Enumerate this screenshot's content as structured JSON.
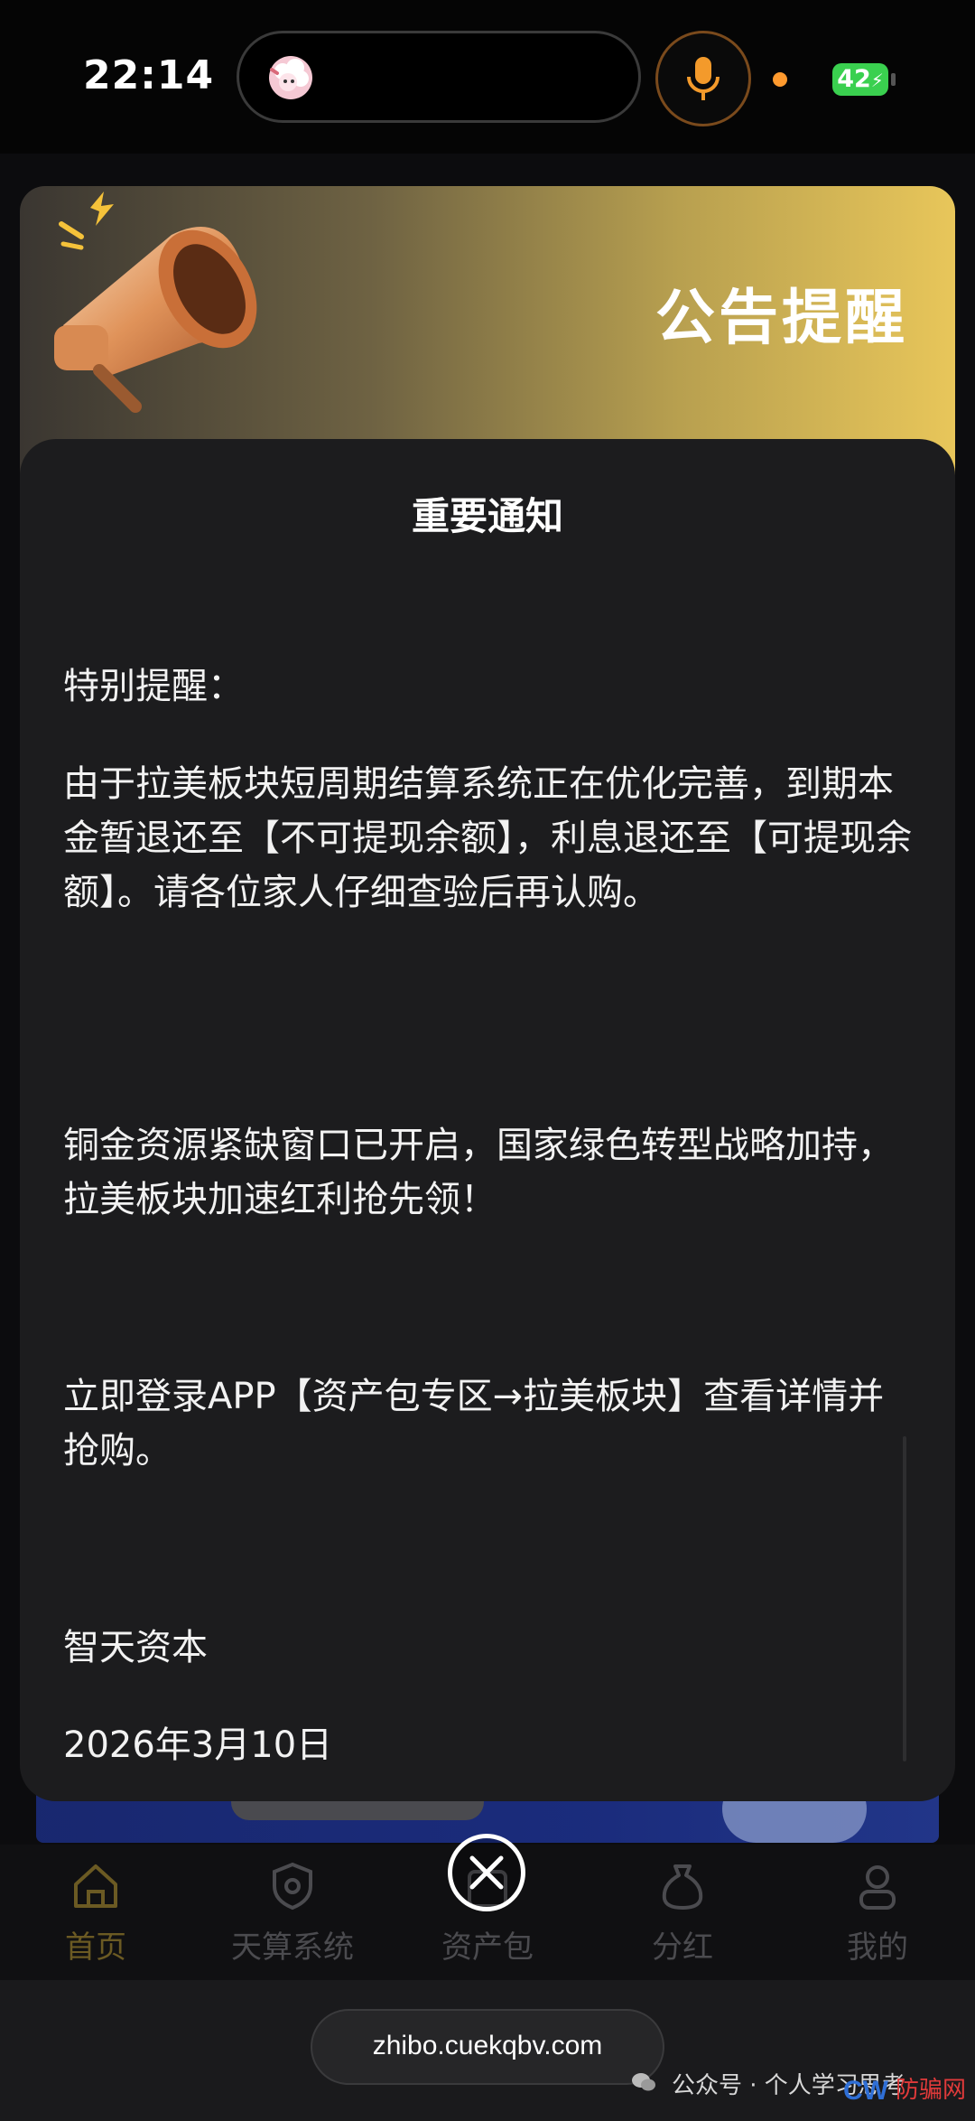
{
  "status_bar": {
    "time": "22:14",
    "battery": "42"
  },
  "modal": {
    "banner_title": "公告提醒",
    "heading": "重要通知",
    "paragraphs": [
      "特别提醒：",
      "由于拉美板块短周期结算系统正在优化完善，到期本金暂退还至【不可提现余额】，利息退还至【可提现余额】。请各位家人仔细查验后再认购。",
      "铜金资源紧缺窗口已开启，国家绿色转型战略加持，拉美板块加速红利抢先领！",
      "立即登录APP【资产包专区→拉美板块】查看详情并抢购。",
      "智天资本",
      "2026年3月10日"
    ]
  },
  "bottom_nav": {
    "items": [
      {
        "label": "首页",
        "icon": "home-icon"
      },
      {
        "label": "天算系统",
        "icon": "shield-gear-icon"
      },
      {
        "label": "资产包",
        "icon": "package-icon"
      },
      {
        "label": "分红",
        "icon": "money-bag-icon"
      },
      {
        "label": "我的",
        "icon": "user-icon"
      }
    ]
  },
  "browser": {
    "url": "zhibo.cuekqbv.com"
  },
  "watermark": {
    "text": "公众号 · 个人学习思考"
  },
  "colors": {
    "accent_gold": "#e8c65a",
    "battery_green": "#3ad04f",
    "active_nav": "#6b5a23"
  }
}
